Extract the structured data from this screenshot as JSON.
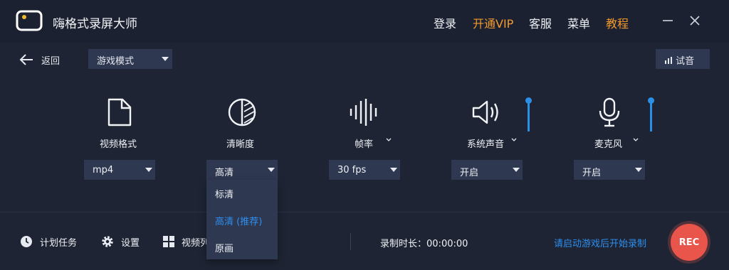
{
  "app": {
    "title": "嗨格式录屏大师"
  },
  "header": {
    "login": "登录",
    "vip": "开通VIP",
    "service": "客服",
    "menu": "菜单",
    "tutorial": "教程"
  },
  "toolbar": {
    "back_label": "返回",
    "mode_value": "游戏模式",
    "test_audio_label": "试音"
  },
  "controls": {
    "format": {
      "label": "视频格式",
      "value": "mp4"
    },
    "quality": {
      "label": "清晰度",
      "value": "高清",
      "options": [
        "标清",
        "高清 (推荐)",
        "原画"
      ],
      "selected_index": 1
    },
    "fps": {
      "label": "帧率",
      "value": "30 fps"
    },
    "system_audio": {
      "label": "系统声音",
      "value": "开启",
      "volume": 1.0
    },
    "microphone": {
      "label": "麦克风",
      "value": "开启",
      "volume": 1.0
    }
  },
  "footer": {
    "schedule_label": "计划任务",
    "settings_label": "设置",
    "video_list_label": "视频列",
    "record_time_label": "录制时长：",
    "record_time_value": "00:00:00",
    "hint": "请启动游戏后开始录制",
    "rec_label": "REC"
  },
  "colors": {
    "background": "#1e2433",
    "panel": "#2e3850",
    "accent_orange": "#f39a2d",
    "accent_blue": "#2e8ff0",
    "rec_red": "#e9554a"
  }
}
